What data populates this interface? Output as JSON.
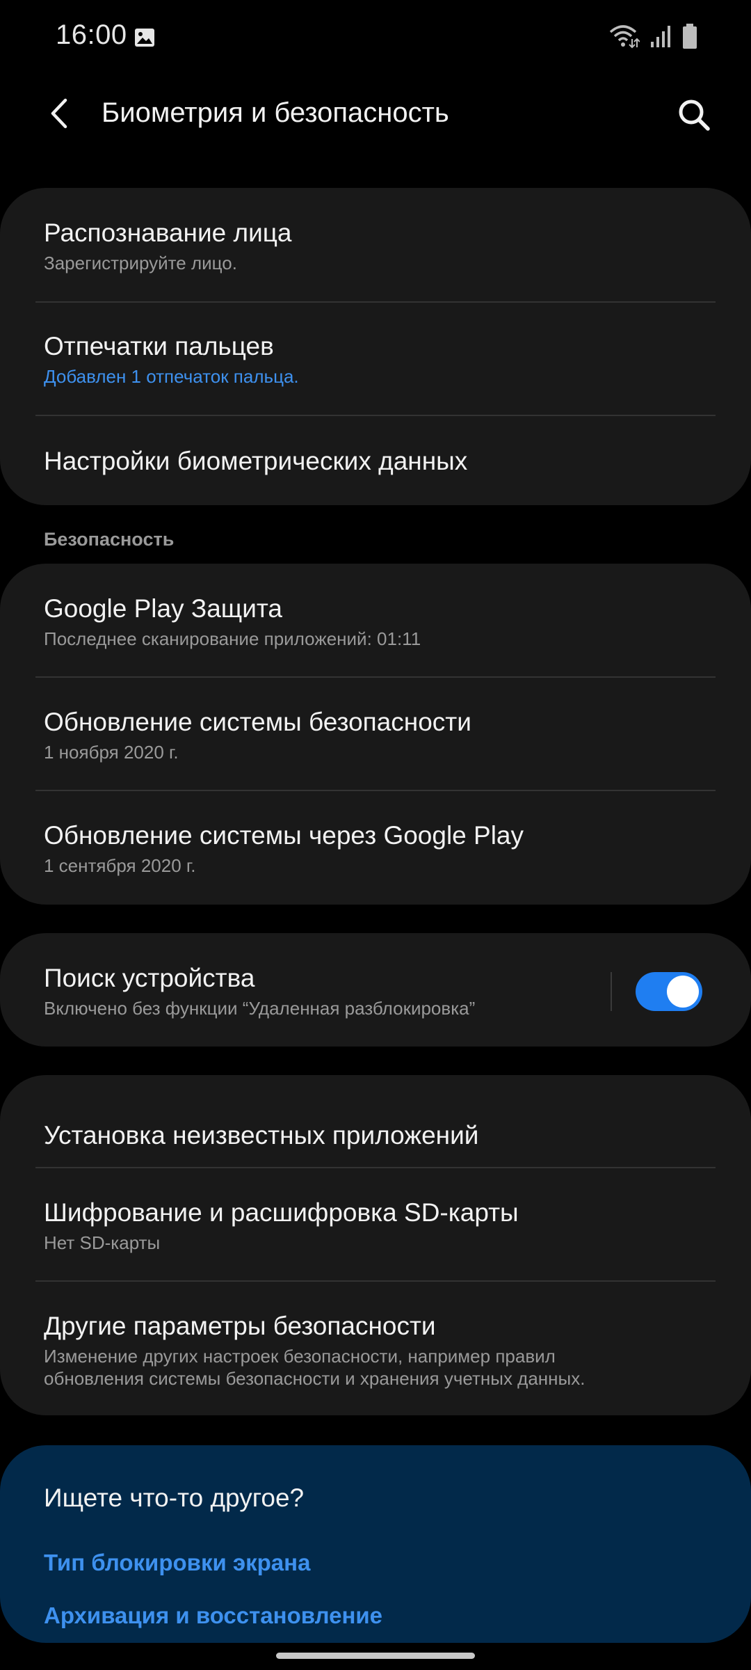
{
  "status_bar": {
    "time": "16:00",
    "icons": [
      "gallery-icon",
      "wifi-icon",
      "signal-icon",
      "battery-icon"
    ]
  },
  "app_bar": {
    "title": "Биометрия и безопасность",
    "back_icon": "back-arrow-icon",
    "search_icon": "search-icon"
  },
  "biometrics": {
    "items": [
      {
        "title": "Распознавание лица",
        "subtitle": "Зарегистрируйте лицо."
      },
      {
        "title": "Отпечатки пальцев",
        "subtitle": "Добавлен 1 отпечаток пальца."
      },
      {
        "title": "Настройки биометрических данных"
      }
    ]
  },
  "security": {
    "header": "Безопасность",
    "items": [
      {
        "title": "Google Play Защита",
        "subtitle": "Последнее сканирование приложений: 01:11"
      },
      {
        "title": "Обновление системы безопасности",
        "subtitle": "1 ноября 2020 г."
      },
      {
        "title": "Обновление системы через Google Play",
        "subtitle": "1 сентября 2020 г."
      }
    ]
  },
  "find_device": {
    "title": "Поиск устройства",
    "subtitle": "Включено без функции “Удаленная разблокировка”",
    "toggle_on": true
  },
  "other": {
    "items": [
      {
        "title": "Установка неизвестных приложений"
      },
      {
        "title": "Шифрование и расшифровка SD-карты",
        "subtitle": "Нет SD-карты"
      },
      {
        "title": "Другие параметры безопасности",
        "subtitle_line1": "Изменение других настроек безопасности, например правил",
        "subtitle_line2": "обновления системы безопасности и хранения учетных данных."
      }
    ]
  },
  "suggestions": {
    "title": "Ищете что-то другое?",
    "links": [
      "Тип блокировки экрана",
      "Архивация и восстановление"
    ]
  },
  "colors": {
    "background": "#000000",
    "card": "#191919",
    "accent": "#3e91ef",
    "toggle": "#1f7ef1",
    "suggest_card": "#02294a"
  }
}
